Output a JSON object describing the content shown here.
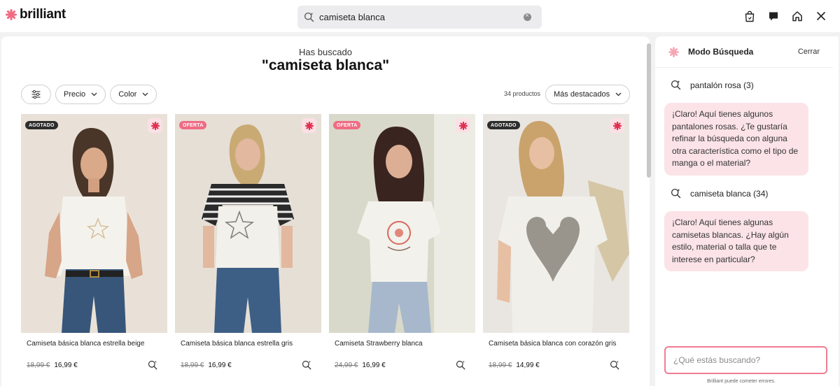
{
  "brand": {
    "name": "brilliant",
    "accent": "#f06b83"
  },
  "search": {
    "value": "camiseta blanca"
  },
  "header": {
    "icons": [
      "shopping-bag-icon",
      "chat-icon",
      "home-icon",
      "close-icon"
    ]
  },
  "main": {
    "searched_label": "Has buscado",
    "query_display": "\"camiseta blanca\"",
    "filters": {
      "price_label": "Precio",
      "color_label": "Color"
    },
    "count_text": "34 productos",
    "sort_label": "Más destacados",
    "products": [
      {
        "title": "Camiseta básica blanca estrella beige",
        "badge": "AGOTADO",
        "old_price": "18,99 €",
        "price": "16,99 €"
      },
      {
        "title": "Camiseta básica blanca estrella gris",
        "badge": "OFERTA",
        "old_price": "18,99 €",
        "price": "16,99 €"
      },
      {
        "title": "Camiseta Strawberry blanca",
        "badge": "OFERTA",
        "old_price": "24,99 €",
        "price": "16,99 €"
      },
      {
        "title": "Camiseta básica blanca con corazón gris",
        "badge": "AGOTADO",
        "old_price": "18,99 €",
        "price": "14,99 €"
      }
    ]
  },
  "chat": {
    "title": "Modo Búsqueda",
    "close_label": "Cerrar",
    "messages": [
      {
        "query": "pantalón rosa (3)",
        "reply": "¡Claro! Aquí tienes algunos pantalones rosas. ¿Te gustaría refinar la búsqueda con alguna otra característica como el tipo de manga o el material?"
      },
      {
        "query": "camiseta blanca (34)",
        "reply": "¡Claro! Aquí tienes algunas camisetas blancas. ¿Hay algún estilo, material o talla que te interese en particular?"
      }
    ],
    "input_placeholder": "¿Qué estás buscando?",
    "disclaimer": "Brilliant puede cometer errores."
  }
}
